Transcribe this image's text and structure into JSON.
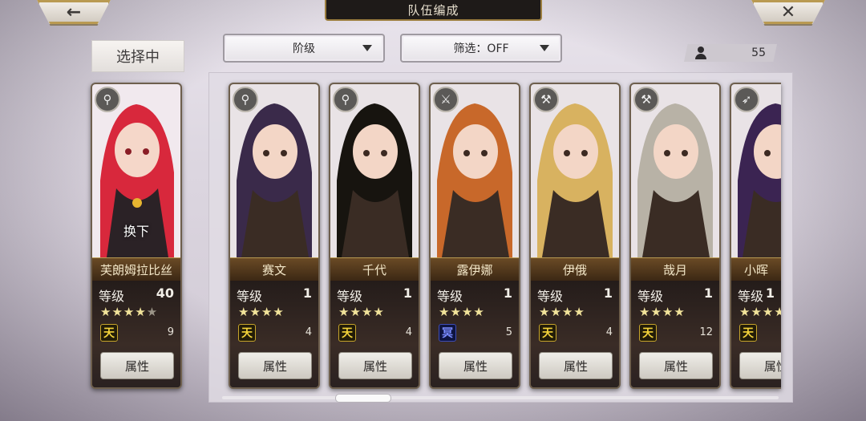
{
  "header": {
    "title": "队伍编成",
    "back_icon": "←",
    "close_icon": "✕"
  },
  "selecting_label": "选择中",
  "filters": {
    "rank_label": "阶级",
    "filter_label": "筛选：OFF"
  },
  "unit_count": "55",
  "selected_card": {
    "name": "芙朗姆拉比丝",
    "level_label": "等级",
    "level": "40",
    "stars_filled": "★★★★",
    "stars_empty": "★",
    "badge": "天",
    "count": "9",
    "swap_label": "换下",
    "attr_label": "属性",
    "weapon_icon": "⚲",
    "hair_color": "#d8283c"
  },
  "cards": [
    {
      "name": "赛文",
      "level_label": "等级",
      "level": "1",
      "stars_filled": "★★★★",
      "badge": "天",
      "badge_type": "gold",
      "count": "4",
      "attr_label": "属性",
      "weapon_icon": "⚲",
      "hair_color": "#3a2a4a"
    },
    {
      "name": "千代",
      "level_label": "等级",
      "level": "1",
      "stars_filled": "★★★★",
      "badge": "天",
      "badge_type": "gold",
      "count": "4",
      "attr_label": "属性",
      "weapon_icon": "⚲",
      "hair_color": "#17140f"
    },
    {
      "name": "露伊娜",
      "level_label": "等级",
      "level": "1",
      "stars_filled": "★★★★",
      "badge": "冥",
      "badge_type": "blue",
      "count": "5",
      "attr_label": "属性",
      "weapon_icon": "⚔",
      "hair_color": "#c8682a"
    },
    {
      "name": "伊俄",
      "level_label": "等级",
      "level": "1",
      "stars_filled": "★★★★",
      "badge": "天",
      "badge_type": "gold",
      "count": "4",
      "attr_label": "属性",
      "weapon_icon": "⚒",
      "hair_color": "#d8b260"
    },
    {
      "name": "哉月",
      "level_label": "等级",
      "level": "1",
      "stars_filled": "★★★★",
      "badge": "天",
      "badge_type": "gold",
      "count": "12",
      "attr_label": "属性",
      "weapon_icon": "⚒",
      "hair_color": "#b8b2a6"
    },
    {
      "name": "小晖",
      "level_label": "等级",
      "level": "1",
      "stars_filled": "★★★★",
      "badge": "天",
      "badge_type": "gold",
      "count": "",
      "attr_label": "属性",
      "weapon_icon": "➶",
      "hair_color": "#3b2452"
    }
  ]
}
